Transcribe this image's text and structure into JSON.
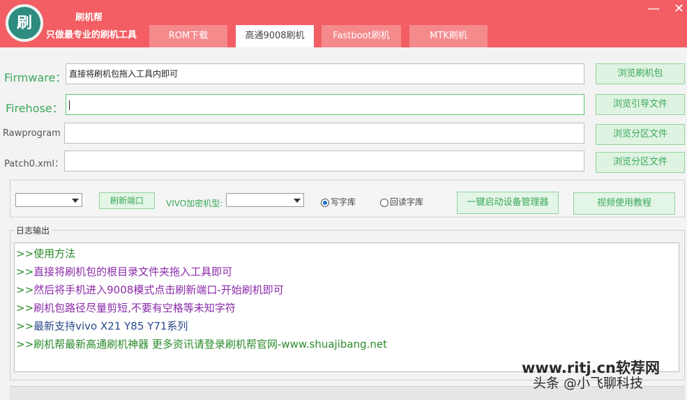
{
  "app": {
    "logo_char": "刷",
    "title": "刷机帮",
    "slogan": "只做最专业的刷机工具",
    "minimize": "—",
    "close": "✕"
  },
  "tabs": [
    {
      "label": "ROM下载"
    },
    {
      "label": "高通9008刷机"
    },
    {
      "label": "Fastboot刷机"
    },
    {
      "label": "MTK刷机"
    }
  ],
  "rows": {
    "firmware": {
      "label": "Firmware：",
      "value": "直接将刷机包拖入工具内即可",
      "button": "浏览刷机包"
    },
    "firehose": {
      "label": "Firehose：",
      "value": "",
      "button": "浏览引导文件"
    },
    "rawprogram": {
      "label": "Rawprogram",
      "value": "",
      "button": "浏览分区文件"
    },
    "patch0": {
      "label": "Patch0.xml：",
      "value": "",
      "button": "浏览分区文件"
    }
  },
  "controls": {
    "port_select_value": "",
    "refresh_port": "刷新端口",
    "vivo_label": "VIVO加密机型:",
    "vivo_select_value": "",
    "radio_write": "写字库",
    "radio_read": "回读字库",
    "device_manager": "一键启动设备管理器",
    "video_tutorial": "视频使用教程"
  },
  "log": {
    "title": "日志输出",
    "prefix": ">>",
    "lines": [
      {
        "text": "使用方法",
        "color": "#2a8a2a"
      },
      {
        "text": "直接将刷机包的根目录文件夹拖入工具即可",
        "color": "#8a2aa8"
      },
      {
        "text": "然后将手机进入9008模式点击刷新端口-开始刷机即可",
        "color": "#8a2aa8"
      },
      {
        "text": "刷机包路径尽量剪短,不要有空格等未知字符",
        "color": "#8a2aa8"
      },
      {
        "text": "最新支持vivo X21 Y85 Y71系列",
        "color": "#2a4a8a"
      },
      {
        "text": "刷机帮最新高通刷机神器 更多资讯请登录刷机帮官网-www.shuajibang.net",
        "color": "#2a8a2a"
      }
    ]
  },
  "watermark": {
    "line1": "www.ritj.cn软荐网",
    "line2": "头条 @小飞聊科技"
  },
  "colors": {
    "titlebar": "#f25e63",
    "accent_green": "#3aa85a"
  }
}
